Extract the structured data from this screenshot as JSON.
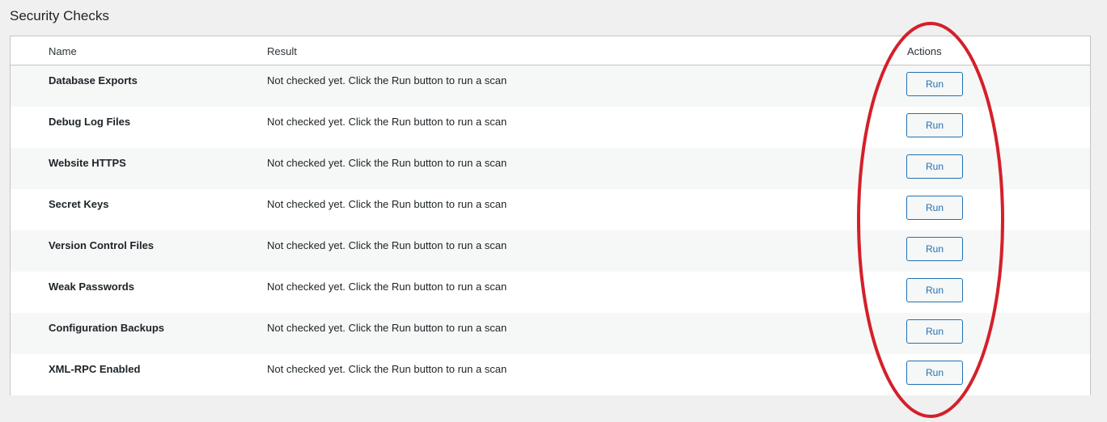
{
  "section": {
    "title": "Security Checks"
  },
  "table": {
    "headers": {
      "name": "Name",
      "result": "Result",
      "actions": "Actions"
    },
    "rows": [
      {
        "name": "Database Exports",
        "result": "Not checked yet. Click the Run button to run a scan",
        "action": "Run"
      },
      {
        "name": "Debug Log Files",
        "result": "Not checked yet. Click the Run button to run a scan",
        "action": "Run"
      },
      {
        "name": "Website HTTPS",
        "result": "Not checked yet. Click the Run button to run a scan",
        "action": "Run"
      },
      {
        "name": "Secret Keys",
        "result": "Not checked yet. Click the Run button to run a scan",
        "action": "Run"
      },
      {
        "name": "Version Control Files",
        "result": "Not checked yet. Click the Run button to run a scan",
        "action": "Run"
      },
      {
        "name": "Weak Passwords",
        "result": "Not checked yet. Click the Run button to run a scan",
        "action": "Run"
      },
      {
        "name": "Configuration Backups",
        "result": "Not checked yet. Click the Run button to run a scan",
        "action": "Run"
      },
      {
        "name": "XML-RPC Enabled",
        "result": "Not checked yet. Click the Run button to run a scan",
        "action": "Run"
      }
    ]
  },
  "colors": {
    "accent": "#2271b1",
    "annotation": "#d4202a",
    "border": "#c3c4c7",
    "stripe": "#f6f7f7",
    "page_bg": "#f0f0f1"
  },
  "annotation": {
    "shape": "ellipse",
    "target": "actions-column"
  }
}
